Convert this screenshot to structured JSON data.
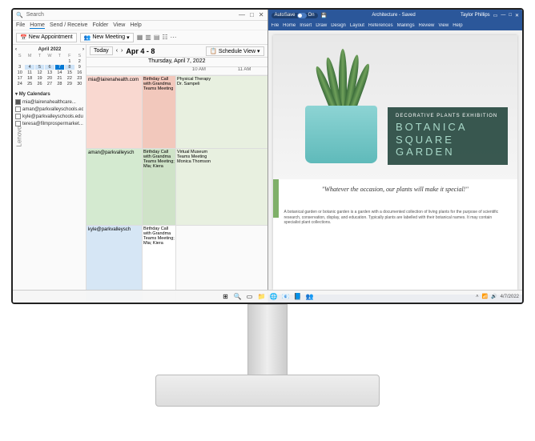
{
  "outlook": {
    "search_placeholder": "Search",
    "menu": [
      "File",
      "Home",
      "Send / Receive",
      "Folder",
      "View",
      "Help"
    ],
    "menu_active": "Home",
    "new_appointment": "New Appointment",
    "new_meeting": "New Meeting",
    "today_btn": "Today",
    "date_range": "Apr 4 - 8",
    "view_label": "Schedule View",
    "day_header": "Thursday, April 7, 2022",
    "times": [
      "10 AM",
      "11 AM"
    ],
    "mini_cal": {
      "month": "April 2022",
      "dow": [
        "S",
        "M",
        "T",
        "W",
        "T",
        "F",
        "S"
      ],
      "days": [
        "",
        "",
        "",
        "",
        "",
        "1",
        "2",
        "3",
        "4",
        "5",
        "6",
        "7",
        "8",
        "9",
        "10",
        "11",
        "12",
        "13",
        "14",
        "15",
        "16",
        "17",
        "18",
        "19",
        "20",
        "21",
        "22",
        "23",
        "24",
        "25",
        "26",
        "27",
        "28",
        "29",
        "30"
      ],
      "today": "7",
      "selected": [
        "4",
        "5",
        "6",
        "7",
        "8"
      ]
    },
    "my_calendars_label": "My Calendars",
    "calendars": [
      {
        "label": "mia@lairenahealthcare...",
        "checked": true
      },
      {
        "label": "aman@parkvalleyschools.edu",
        "checked": false
      },
      {
        "label": "kyle@parkvalleyschools.edu",
        "checked": false
      },
      {
        "label": "teresa@filmprospermarket...",
        "checked": false
      }
    ],
    "schedule": [
      {
        "person": "mia@lairenahealth.com",
        "evt": "Birthday Call with Grandma\nTeams Meeting",
        "free": "Physical Therapy\nDr. Sampeli"
      },
      {
        "person": "aman@parkvalleysch",
        "evt": "Birthday Call with Grandma\nTeams Meeting; Mia; Kiera",
        "free": "Virtual Museum\nTeams Meeting\nMonica Thomson"
      },
      {
        "person": "kyle@parkvalleysch",
        "evt": "Birthday Call with Grandma\nTeams Meeting; Mia; Kiera",
        "free": ""
      }
    ]
  },
  "word": {
    "autosave": "AutoSave",
    "autosave_state": "On",
    "doc_name": "Architecture - Saved",
    "user": "Taylor Phillips",
    "ribbon": [
      "File",
      "Home",
      "Insert",
      "Draw",
      "Design",
      "Layout",
      "References",
      "Mailings",
      "Review",
      "View",
      "Help"
    ],
    "poster": {
      "subtitle": "DECORATIVE PLANTS EXHIBITION",
      "title_l1": "BOTANICA",
      "title_l2": "SQUARE",
      "title_l3": "GARDEN"
    },
    "quote": "\"Whatever the occasion, our plants will make it special!\"",
    "body": "A botanical garden or botanic garden is a garden with a documented collection of living plants for the purpose of scientific research, conservation, display, and education. Typically plants are labelled with their botanical names. It may contain specialist plant collections."
  },
  "taskbar": {
    "date": "4/7/2022"
  }
}
